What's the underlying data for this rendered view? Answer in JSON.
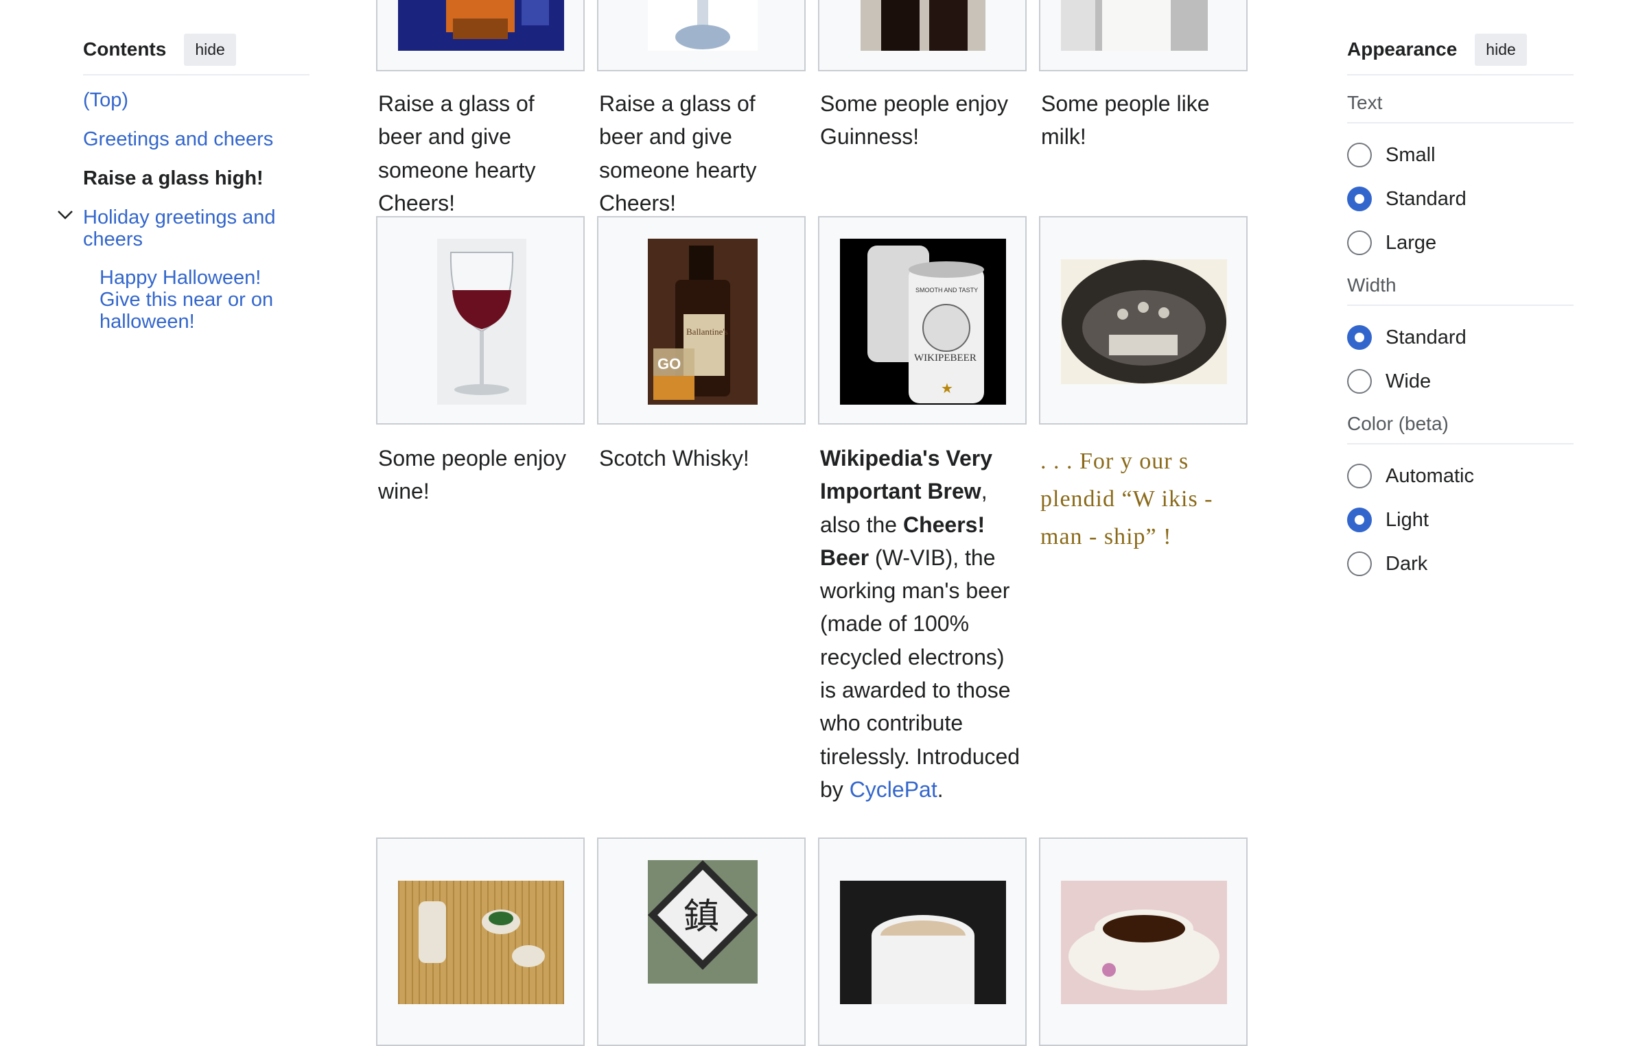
{
  "toc": {
    "title": "Contents",
    "hide_label": "hide",
    "items": [
      {
        "label": "(Top)"
      },
      {
        "label": "Greetings and cheers"
      },
      {
        "label": "Raise a glass high!"
      },
      {
        "label": "Holiday greetings and cheers"
      },
      {
        "label": "Happy Halloween! Give this near or on halloween!"
      }
    ]
  },
  "gallery": {
    "row1": [
      {
        "caption": "Raise a glass of beer and give someone hearty Cheers!"
      },
      {
        "caption": "Raise a glass of beer and give someone hearty Cheers!"
      },
      {
        "caption": "Some people enjoy Guinness!"
      },
      {
        "caption": "Some people like milk!"
      }
    ],
    "row2": [
      {
        "caption": "Some people enjoy wine!"
      },
      {
        "caption": "Scotch Whisky!"
      },
      {
        "bold1": "Wikipedia's Very Important Brew",
        "text1": ", also the ",
        "bold2": "Cheers! Beer",
        "text2": " (W-VIB), the working man's beer (made of 100% recycled electrons) is awarded to those who contribute tirelessly. Introduced by ",
        "link": "CyclePat",
        "text3": "."
      },
      {
        "caption": ". . . For  y our  s plendid  “W ikis - man - ship” !"
      }
    ],
    "can_text_top": "SMOOTH AND TASTY",
    "can_text_brand": "WIKIPEBEER",
    "whisky_label": "Ballantine's",
    "glass_text": "GO",
    "sign_glyph": "鎮"
  },
  "appearance": {
    "title": "Appearance",
    "hide_label": "hide",
    "text_section": {
      "title": "Text",
      "options": [
        {
          "label": "Small",
          "selected": false
        },
        {
          "label": "Standard",
          "selected": true
        },
        {
          "label": "Large",
          "selected": false
        }
      ]
    },
    "width_section": {
      "title": "Width",
      "options": [
        {
          "label": "Standard",
          "selected": true
        },
        {
          "label": "Wide",
          "selected": false
        }
      ]
    },
    "color_section": {
      "title": "Color (beta)",
      "options": [
        {
          "label": "Automatic",
          "selected": false
        },
        {
          "label": "Light",
          "selected": true
        },
        {
          "label": "Dark",
          "selected": false
        }
      ]
    }
  },
  "colors": {
    "link": "#3366cc",
    "radio_selected": "#3366cc",
    "caption_old": "#8a6a1a"
  }
}
